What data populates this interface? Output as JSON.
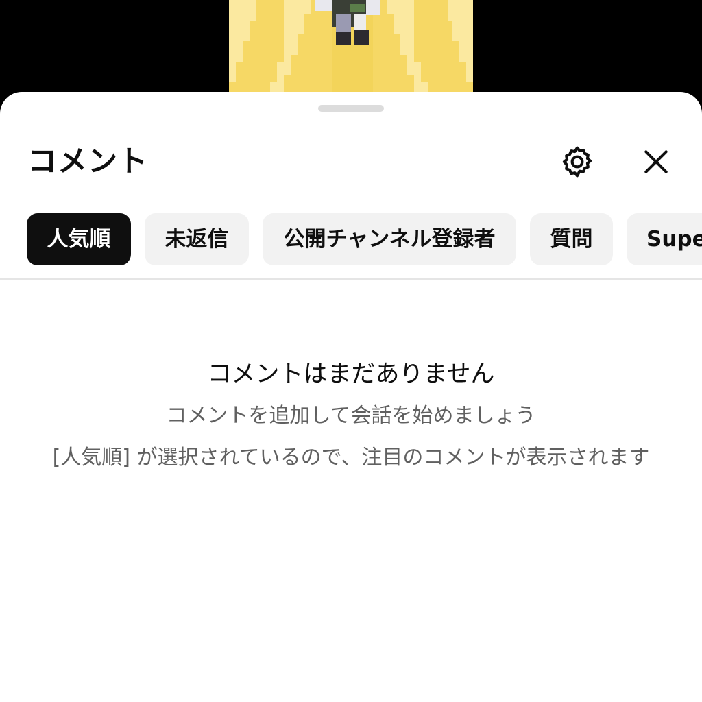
{
  "sheet": {
    "title": "コメント",
    "settings_icon": "gear-icon",
    "close_icon": "close-icon"
  },
  "chips": [
    {
      "label": "人気順",
      "selected": true
    },
    {
      "label": "未返信",
      "selected": false
    },
    {
      "label": "公開チャンネル登録者",
      "selected": false
    },
    {
      "label": "質問",
      "selected": false
    },
    {
      "label": "Supe",
      "selected": false
    }
  ],
  "empty_state": {
    "title": "コメントはまだありません",
    "subtitle": "コメントを追加して会話を始めましょう",
    "note": "[人気順] が選択されているので、注目のコメントが表示されます"
  },
  "colors": {
    "active_chip_bg": "#0f0f0f",
    "chip_bg": "#f2f2f2",
    "text_primary": "#0f0f0f",
    "text_secondary": "#606060",
    "video_yellow": "#f6d865"
  }
}
